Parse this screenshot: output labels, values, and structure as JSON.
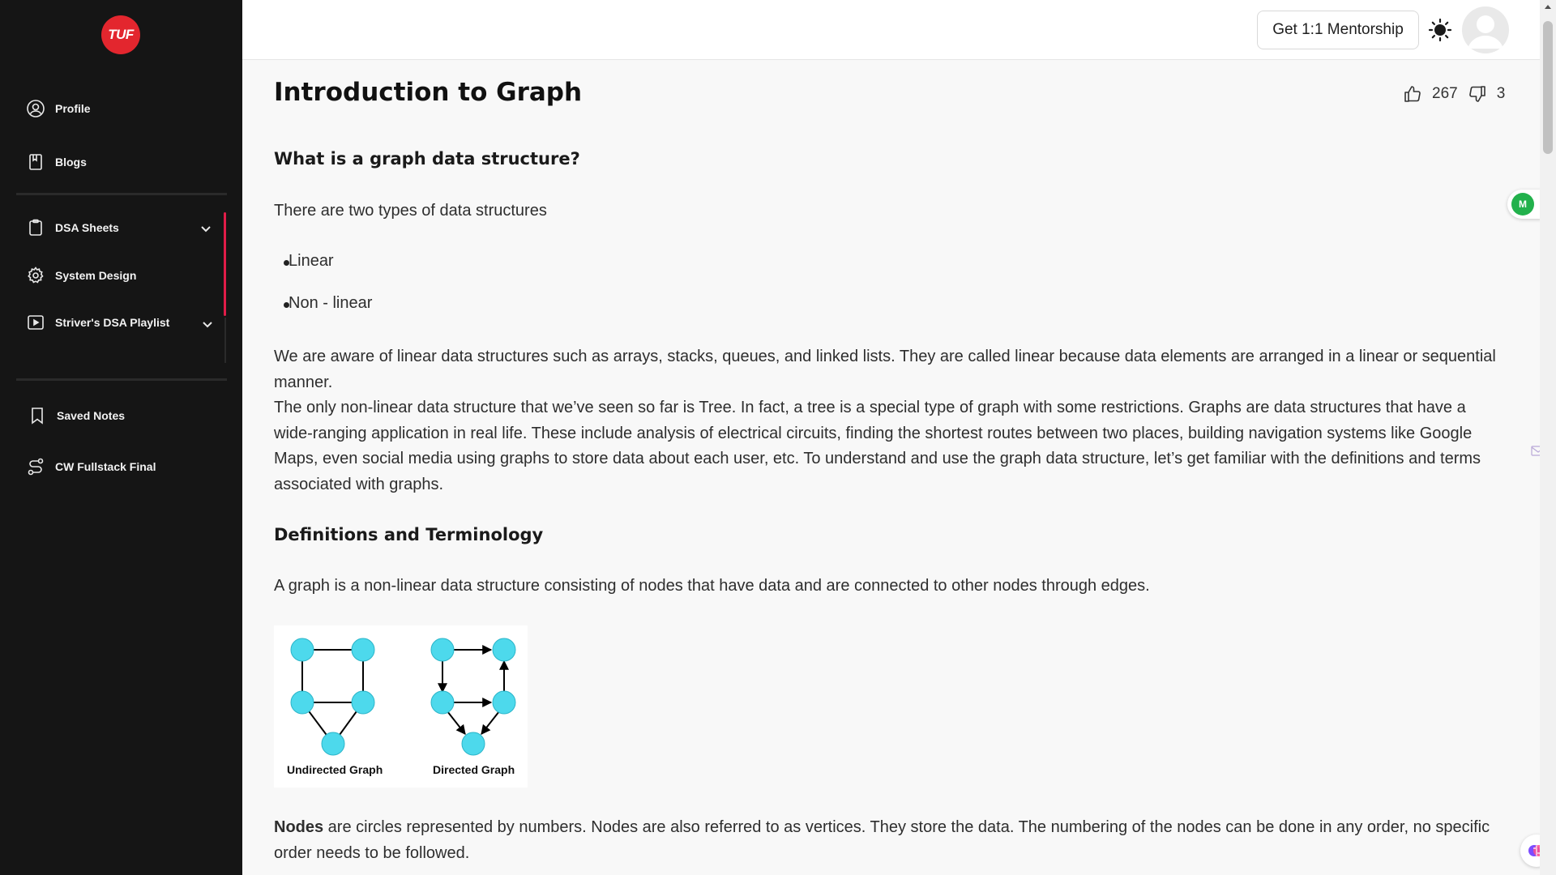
{
  "sidebar": {
    "logo_text": "TUF",
    "items": [
      {
        "label": "Profile",
        "icon": "user-circle-icon"
      },
      {
        "label": "Blogs",
        "icon": "book-icon"
      },
      {
        "label": "DSA Sheets",
        "icon": "clipboard-icon",
        "expandable": true
      },
      {
        "label": "System Design",
        "icon": "gear-icon"
      },
      {
        "label": "Striver's DSA Playlist",
        "icon": "play-icon",
        "expandable": true
      },
      {
        "label": "Saved Notes",
        "icon": "bookmark-icon"
      },
      {
        "label": "CW Fullstack Final",
        "icon": "route-icon"
      }
    ],
    "accent_color": "#e11d48"
  },
  "header": {
    "mentorship_label": "Get 1:1 Mentorship",
    "theme_icon": "sun-icon",
    "avatar_icon": "avatar-icon"
  },
  "article": {
    "title": "Introduction to Graph",
    "likes": "267",
    "dislikes": "3",
    "h_what": "What is a graph data structure?",
    "p_types": "There are two types of data structures",
    "list": [
      "Linear",
      "Non - linear"
    ],
    "p_linear": "We are aware of linear data structures such as arrays, stacks, queues, and linked lists. They are called linear because data elements are arranged in a linear or sequential manner.",
    "p_nonlinear": "The only non-linear data structure that we’ve seen so far is Tree. In fact, a tree is a special type of graph with some restrictions. Graphs are data structures that have a wide-ranging application in real life. These include analysis of electrical circuits, finding the shortest routes between two places, building navigation systems like Google Maps, even social media using graphs to store data about each user, etc. To understand and use the graph data structure, let’s get familiar with the definitions and terms associated with graphs.",
    "h_defs": "Definitions and Terminology",
    "p_graph": "A graph is a non-linear data structure consisting of nodes that have data and are connected to other nodes through edges.",
    "figure": {
      "left_label": "Undirected Graph",
      "right_label": "Directed Graph",
      "node_color": "#4dd9ec"
    },
    "nodes_bold": "Nodes",
    "p_nodes": " are circles represented by numbers. Nodes are also referred to as vertices. They store the data. The numbering of the nodes can be done in any order, no specific order needs to be followed."
  },
  "floating": {
    "m_badge": "M"
  }
}
